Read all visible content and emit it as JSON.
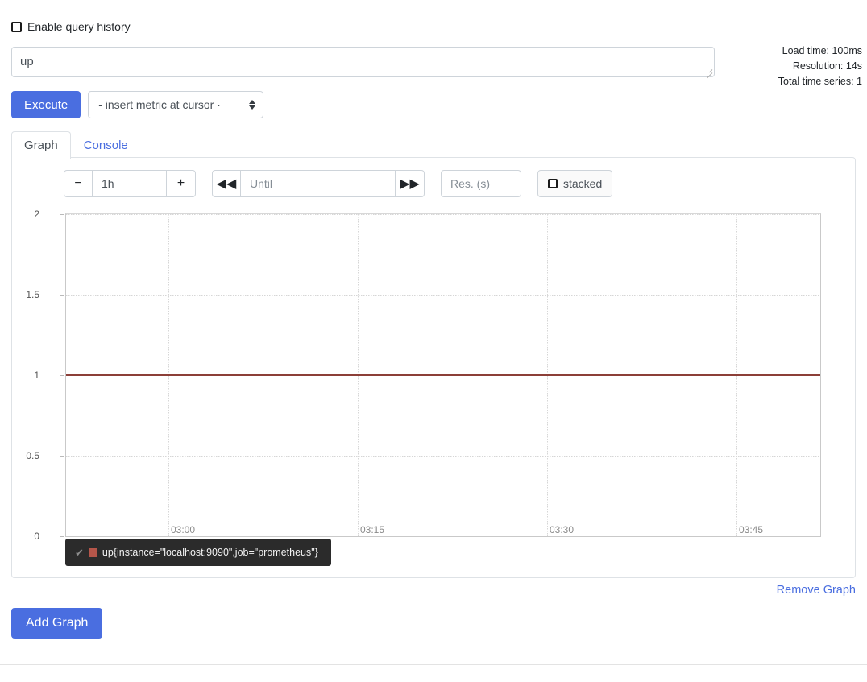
{
  "query_history": {
    "label": "Enable query history",
    "checked": false
  },
  "expression": {
    "value": "up",
    "placeholder": "Expression (press Shift+Enter for newlines)"
  },
  "stats": {
    "load_time": "Load time: 100ms",
    "resolution": "Resolution: 14s",
    "total_series": "Total time series: 1"
  },
  "toolbar": {
    "execute_label": "Execute",
    "metric_select_label": "- insert metric at cursor ·"
  },
  "tabs": [
    {
      "label": "Graph",
      "active": true
    },
    {
      "label": "Console",
      "active": false
    }
  ],
  "graph_controls": {
    "decrease_label": "−",
    "range_value": "1h",
    "increase_label": "+",
    "back_label": "◀◀",
    "until_placeholder": "Until",
    "until_value": "",
    "forward_label": "▶▶",
    "resolution_placeholder": "Res. (s)",
    "resolution_value": "",
    "stacked_label": "stacked",
    "stacked_checked": false
  },
  "legend": {
    "check_glyph": "✔",
    "series_label": "up{instance=\"localhost:9090\",job=\"prometheus\"}",
    "swatch_color": "#b5564a"
  },
  "actions": {
    "remove_graph": "Remove Graph",
    "add_graph": "Add Graph"
  },
  "colors": {
    "primary": "#4a6ee0",
    "series": "#8c3f38",
    "link": "#4a6ee0"
  },
  "chart_data": {
    "type": "line",
    "title": "",
    "xlabel": "",
    "ylabel": "",
    "ylim": [
      0,
      2
    ],
    "yticks": [
      "0",
      "0.5",
      "1",
      "1.5",
      "2"
    ],
    "xticks": [
      "03:00",
      "03:15",
      "03:30",
      "03:45"
    ],
    "grid": true,
    "legend_position": "bottom-left",
    "series": [
      {
        "name": "up{instance=\"localhost:9090\",job=\"prometheus\"}",
        "color": "#8c3f38",
        "constant_value": 1,
        "x": [
          "03:00",
          "03:15",
          "03:30",
          "03:45"
        ],
        "values": [
          1,
          1,
          1,
          1
        ]
      }
    ]
  }
}
